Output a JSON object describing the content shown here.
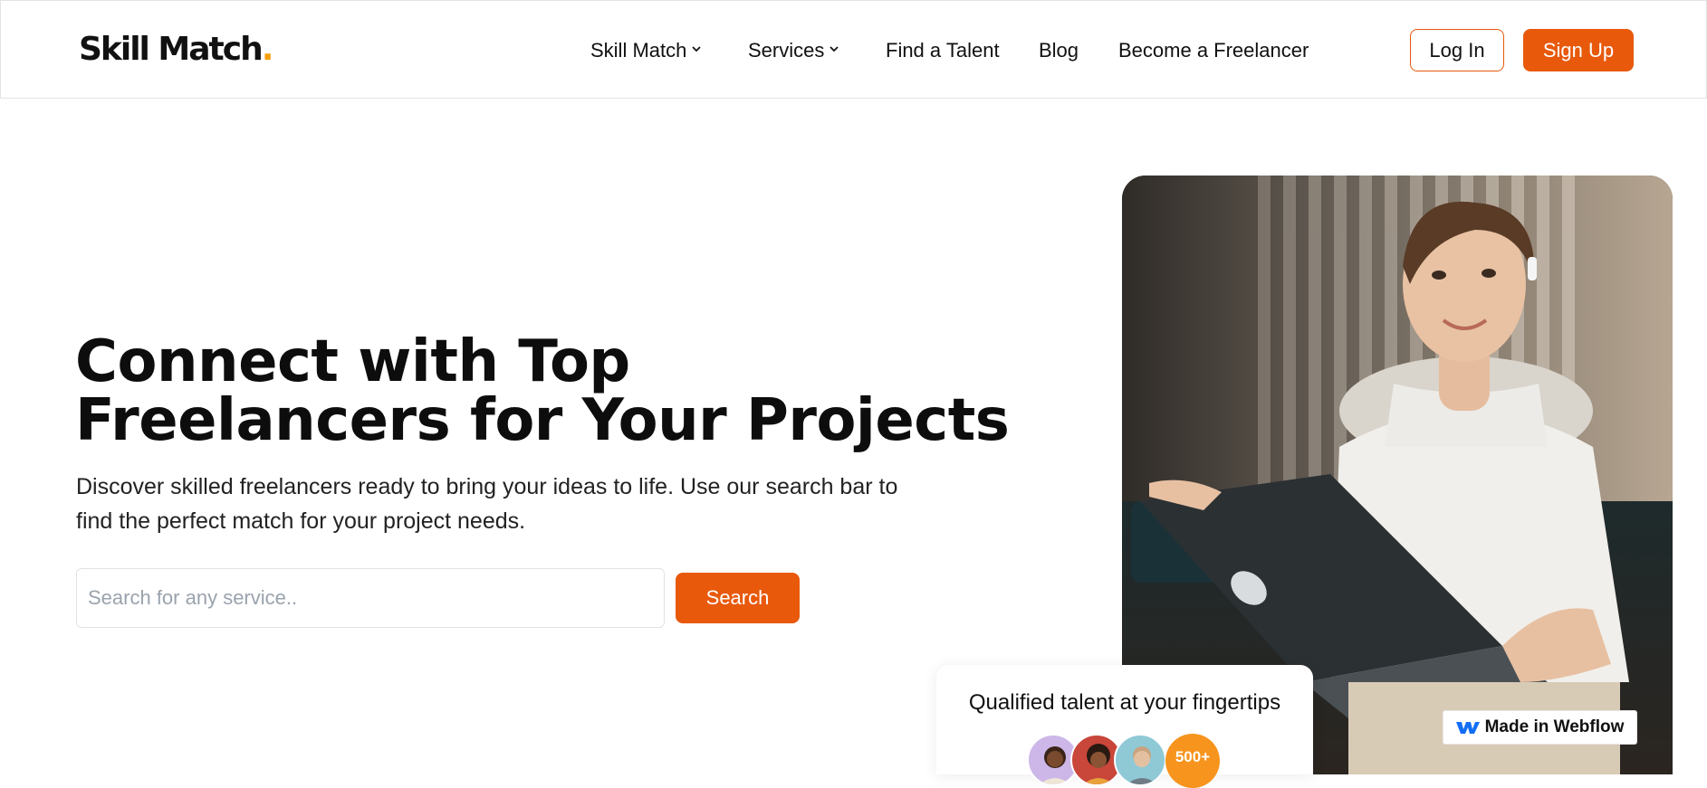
{
  "nav": {
    "logo": "Skill Match",
    "logo_dot": ".",
    "items": [
      {
        "label": "Skill Match"
      },
      {
        "label": "Services"
      },
      {
        "label": "Find a Talent"
      },
      {
        "label": "Blog"
      },
      {
        "label": "Become a Freelancer"
      }
    ],
    "login_label": "Log In",
    "signup_label": "Sign Up"
  },
  "hero": {
    "title_line1": "Connect with Top",
    "title_line2": "Freelancers for Your Projects",
    "description": "Discover skilled freelancers ready to bring your ideas to life. Use our search bar to find the perfect match for your project needs.",
    "search_placeholder": "Search for any service..",
    "search_button": "Search"
  },
  "talent_card": {
    "text": "Qualified talent at your fingertips",
    "count": "500+"
  },
  "badge": {
    "label": "Made in Webflow"
  },
  "colors": {
    "accent": "#e8590c",
    "logo_dot": "#f59e0b",
    "count_badge": "#f7941d"
  }
}
